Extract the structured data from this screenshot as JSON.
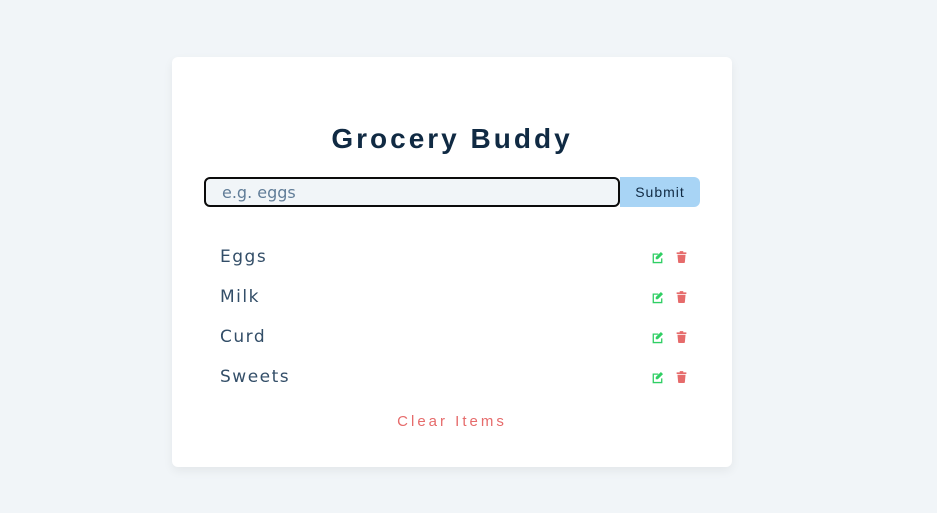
{
  "app": {
    "title": "Grocery Buddy"
  },
  "form": {
    "input_value": "",
    "input_placeholder": "e.g. eggs",
    "submit_label": "Submit"
  },
  "items": [
    {
      "name": "Eggs"
    },
    {
      "name": "Milk"
    },
    {
      "name": "Curd"
    },
    {
      "name": "Sweets"
    }
  ],
  "item_actions": {
    "edit_icon": "edit-icon",
    "delete_icon": "trash-icon"
  },
  "clear_label": "Clear Items",
  "colors": {
    "background": "#f1f5f8",
    "card": "#ffffff",
    "title": "#102a43",
    "submit_bg": "#a8d4f5",
    "edit": "#2fcf63",
    "delete": "#e66b6b",
    "clear": "#e66b6b"
  }
}
